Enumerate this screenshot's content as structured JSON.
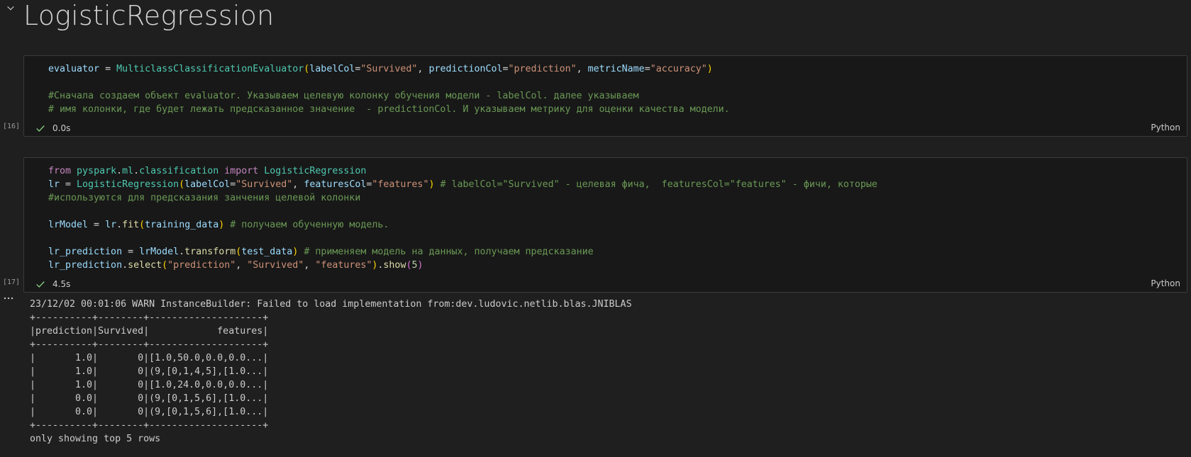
{
  "markdown": {
    "title": "LogisticRegression"
  },
  "cells": [
    {
      "execution_count": "[16]",
      "status_time": "0.0s",
      "language": "Python",
      "lines": [
        [
          {
            "t": "evaluator",
            "c": "var"
          },
          {
            "t": " = ",
            "c": "op"
          },
          {
            "t": "MulticlassClassificationEvaluator",
            "c": "cls"
          },
          {
            "t": "(",
            "c": "br1"
          },
          {
            "t": "labelCol",
            "c": "var"
          },
          {
            "t": "=",
            "c": "op"
          },
          {
            "t": "\"Survived\"",
            "c": "str"
          },
          {
            "t": ", ",
            "c": "op"
          },
          {
            "t": "predictionCol",
            "c": "var"
          },
          {
            "t": "=",
            "c": "op"
          },
          {
            "t": "\"prediction\"",
            "c": "str"
          },
          {
            "t": ", ",
            "c": "op"
          },
          {
            "t": "metricName",
            "c": "var"
          },
          {
            "t": "=",
            "c": "op"
          },
          {
            "t": "\"accuracy\"",
            "c": "str"
          },
          {
            "t": ")",
            "c": "br1"
          }
        ],
        [],
        [
          {
            "t": "#Сначала создаем объект evaluator. Указываем целевую колонку обучения модели - labelCol. далее указываем",
            "c": "cmt"
          }
        ],
        [
          {
            "t": "# имя колонки, где будет лежать предсказанное значение  - predictionCol. И указываем метрику для оценки качества модели.",
            "c": "cmt"
          }
        ]
      ]
    },
    {
      "execution_count": "[17]",
      "status_time": "4.5s",
      "language": "Python",
      "lines": [
        [
          {
            "t": "from",
            "c": "kw"
          },
          {
            "t": " ",
            "c": "op"
          },
          {
            "t": "pyspark",
            "c": "cls"
          },
          {
            "t": ".",
            "c": "op"
          },
          {
            "t": "ml",
            "c": "cls"
          },
          {
            "t": ".",
            "c": "op"
          },
          {
            "t": "classification",
            "c": "cls"
          },
          {
            "t": " ",
            "c": "op"
          },
          {
            "t": "import",
            "c": "kw"
          },
          {
            "t": " ",
            "c": "op"
          },
          {
            "t": "LogisticRegression",
            "c": "cls"
          }
        ],
        [
          {
            "t": "lr",
            "c": "var"
          },
          {
            "t": " = ",
            "c": "op"
          },
          {
            "t": "LogisticRegression",
            "c": "cls"
          },
          {
            "t": "(",
            "c": "br1"
          },
          {
            "t": "labelCol",
            "c": "var"
          },
          {
            "t": "=",
            "c": "op"
          },
          {
            "t": "\"Survived\"",
            "c": "str"
          },
          {
            "t": ", ",
            "c": "op"
          },
          {
            "t": "featuresCol",
            "c": "var"
          },
          {
            "t": "=",
            "c": "op"
          },
          {
            "t": "\"features\"",
            "c": "str"
          },
          {
            "t": ")",
            "c": "br1"
          },
          {
            "t": " # labelCol=\"Survived\" - целевая фича,  featuresCol=\"features\" - фичи, которые",
            "c": "cmt"
          }
        ],
        [
          {
            "t": "#используются для предсказания занчения целевой колонки",
            "c": "cmt"
          }
        ],
        [],
        [
          {
            "t": "lrModel",
            "c": "var"
          },
          {
            "t": " = ",
            "c": "op"
          },
          {
            "t": "lr",
            "c": "var"
          },
          {
            "t": ".",
            "c": "op"
          },
          {
            "t": "fit",
            "c": "fn"
          },
          {
            "t": "(",
            "c": "br1"
          },
          {
            "t": "training_data",
            "c": "var"
          },
          {
            "t": ")",
            "c": "br1"
          },
          {
            "t": " # получаем обученную модель.",
            "c": "cmt"
          }
        ],
        [],
        [
          {
            "t": "lr_prediction",
            "c": "var"
          },
          {
            "t": " = ",
            "c": "op"
          },
          {
            "t": "lrModel",
            "c": "var"
          },
          {
            "t": ".",
            "c": "op"
          },
          {
            "t": "transform",
            "c": "fn"
          },
          {
            "t": "(",
            "c": "br1"
          },
          {
            "t": "test_data",
            "c": "var"
          },
          {
            "t": ")",
            "c": "br1"
          },
          {
            "t": " # применяем модель на данных, получаем предсказание",
            "c": "cmt"
          }
        ],
        [
          {
            "t": "lr_prediction",
            "c": "var"
          },
          {
            "t": ".",
            "c": "op"
          },
          {
            "t": "select",
            "c": "fn"
          },
          {
            "t": "(",
            "c": "br1"
          },
          {
            "t": "\"prediction\"",
            "c": "str"
          },
          {
            "t": ", ",
            "c": "op"
          },
          {
            "t": "\"Survived\"",
            "c": "str"
          },
          {
            "t": ", ",
            "c": "op"
          },
          {
            "t": "\"features\"",
            "c": "str"
          },
          {
            "t": ")",
            "c": "br1"
          },
          {
            "t": ".",
            "c": "op"
          },
          {
            "t": "show",
            "c": "fn"
          },
          {
            "t": "(",
            "c": "br2"
          },
          {
            "t": "5",
            "c": "num"
          },
          {
            "t": ")",
            "c": "br2"
          }
        ]
      ]
    }
  ],
  "output": {
    "lines": [
      "23/12/02 00:01:06 WARN InstanceBuilder: Failed to load implementation from:dev.ludovic.netlib.blas.JNIBLAS",
      "+----------+--------+--------------------+",
      "|prediction|Survived|            features|",
      "+----------+--------+--------------------+",
      "|       1.0|       0|[1.0,50.0,0.0,0.0...|",
      "|       1.0|       0|(9,[0,1,4,5],[1.0...|",
      "|       1.0|       0|[1.0,24.0,0.0,0.0...|",
      "|       0.0|       0|(9,[0,1,5,6],[1.0...|",
      "|       0.0|       0|(9,[0,1,5,6],[1.0...|",
      "+----------+--------+--------------------+",
      "only showing top 5 rows"
    ]
  },
  "icons": {
    "collapse": "chevron-down-icon",
    "success": "check-icon",
    "output_menu": "ellipsis-icon"
  },
  "colors": {
    "background": "#1f1f1f",
    "cell_background": "#181818",
    "success_check": "#89d185"
  }
}
